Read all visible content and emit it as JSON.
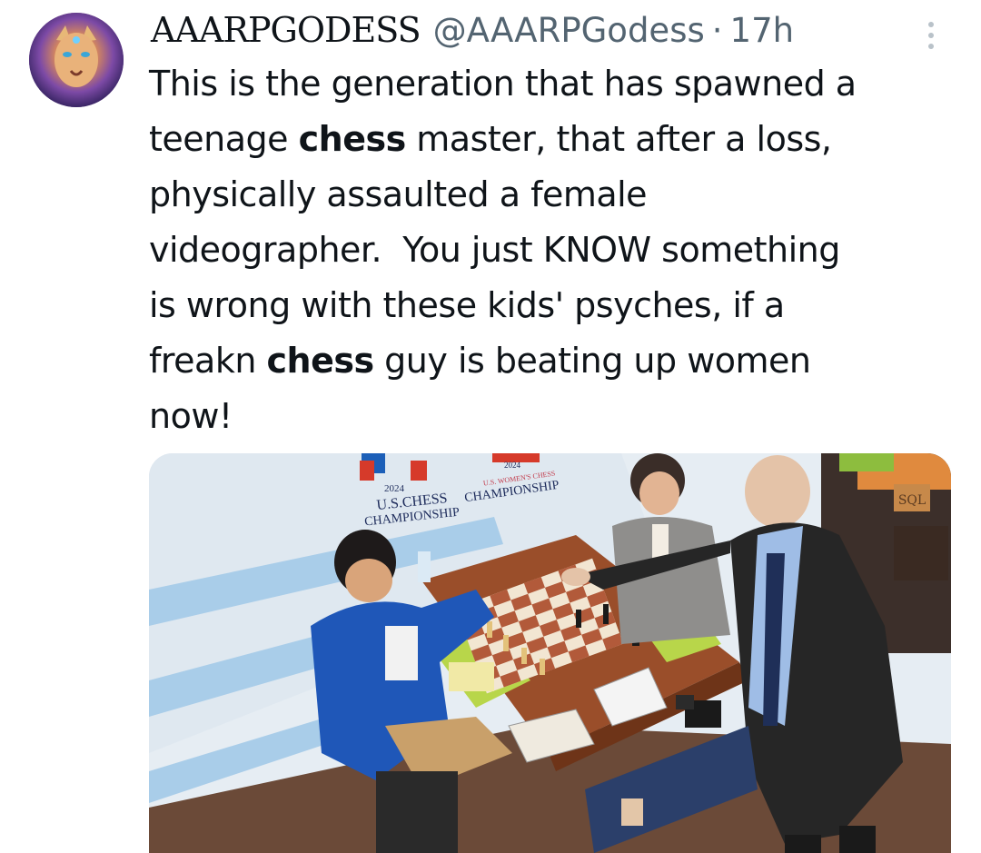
{
  "tweet": {
    "display_name": "AAARPGODESS",
    "handle": "@AAARPGodess",
    "separator": "·",
    "time": "17h",
    "text_parts": [
      "This is the generation that has spawned a\nteenage ",
      "chess",
      " master, that after a loss,\nphysically assaulted a female\nvideographer.  You just KNOW something\nis wrong with these kids' psyches, if a\nfreakn ",
      "chess",
      " guy is beating up women\nnow!"
    ]
  },
  "media": {
    "banner_left_year": "2024",
    "banner_left_line1": "U.S.CHESS",
    "banner_left_line2": "CHAMPIONSHIP",
    "banner_right_year": "2024",
    "banner_right_line1": "U.S. WOMEN'S CHESS",
    "banner_right_line2": "CHAMPIONSHIP",
    "corner_logo": "SQL"
  },
  "icons": {
    "more": "more-vertical-icon",
    "avatar": "lioness-avatar"
  }
}
